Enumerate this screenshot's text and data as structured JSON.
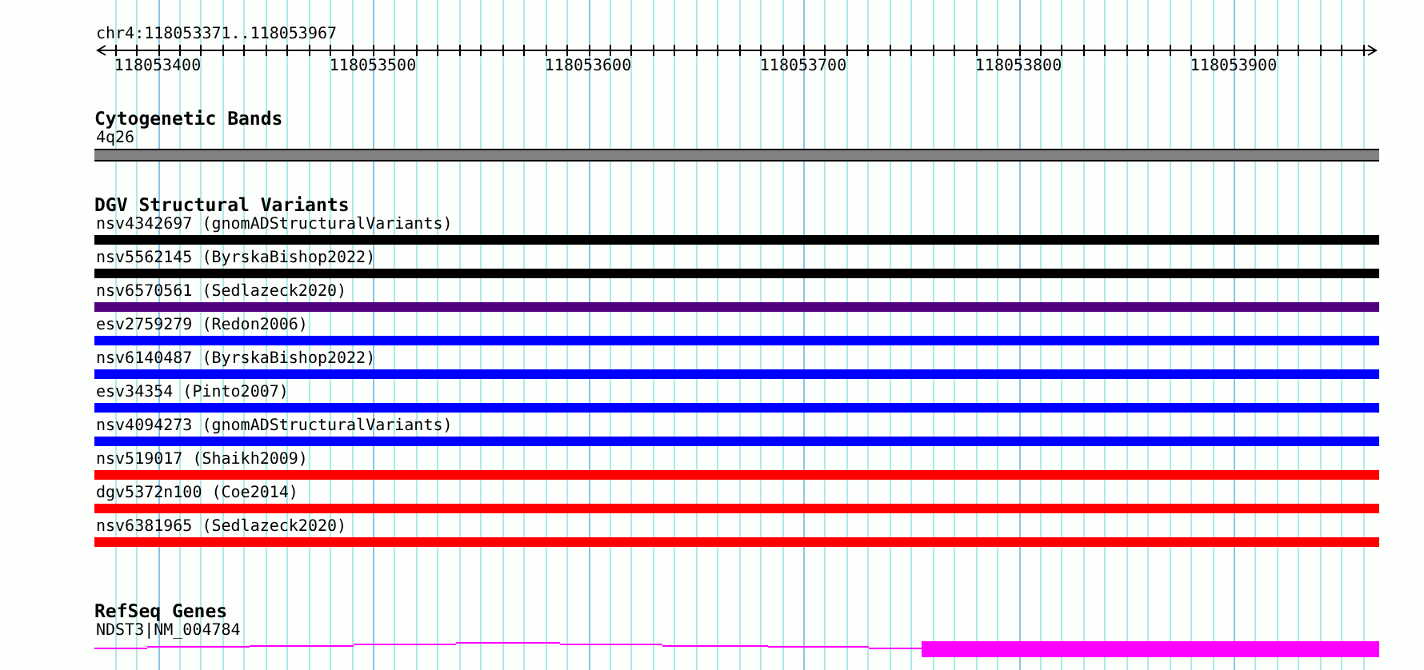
{
  "ruler": {
    "location": "chr4:118053371..118053967",
    "tick_labels": [
      "118053400",
      "118053500",
      "118053600",
      "118053700",
      "118053800",
      "118053900"
    ]
  },
  "tracks": [
    {
      "kind": "band",
      "title": "Cytogenetic Bands",
      "features": [
        {
          "label": "4q26"
        }
      ]
    },
    {
      "kind": "variants",
      "title": "DGV Structural Variants",
      "features": [
        {
          "label": "nsv4342697 (gnomADStructuralVariants)",
          "color": "#000000"
        },
        {
          "label": "nsv5562145 (ByrskaBishop2022)",
          "color": "#000000"
        },
        {
          "label": "nsv6570561 (Sedlazeck2020)",
          "color": "#4f007f"
        },
        {
          "label": "esv2759279 (Redon2006)",
          "color": "#0000ff"
        },
        {
          "label": "nsv6140487 (ByrskaBishop2022)",
          "color": "#0000ff"
        },
        {
          "label": "esv34354 (Pinto2007)",
          "color": "#0000ff"
        },
        {
          "label": "nsv4094273 (gnomADStructuralVariants)",
          "color": "#0000ff"
        },
        {
          "label": "nsv519017 (Shaikh2009)",
          "color": "#ff0000"
        },
        {
          "label": "dgv5372n100 (Coe2014)",
          "color": "#ff0000"
        },
        {
          "label": "nsv6381965 (Sedlazeck2020)",
          "color": "#ff0000"
        }
      ]
    },
    {
      "kind": "genes",
      "title": "RefSeq Genes",
      "features": [
        {
          "label": "NDST3|NM_004784"
        }
      ]
    }
  ]
}
